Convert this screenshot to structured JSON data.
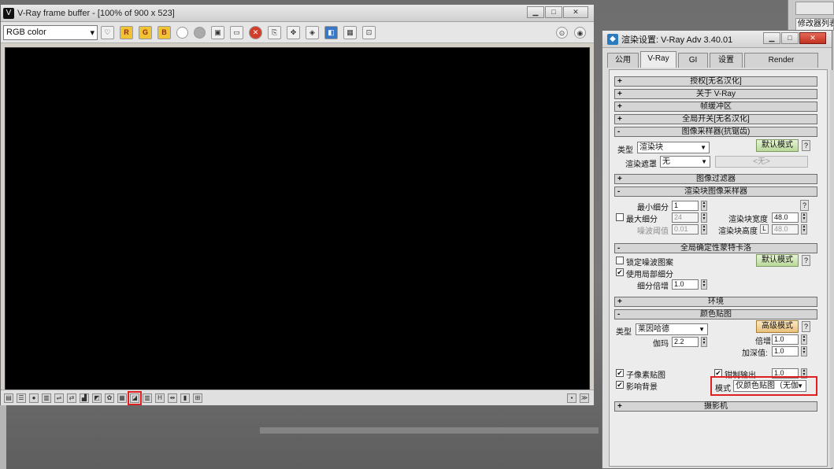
{
  "background": {
    "right_panel_label": "修改器列表"
  },
  "vfb": {
    "app_icon_glyph": "V",
    "title": "V-Ray frame buffer - [100% of 900 x 523]",
    "window_buttons": [
      "▁",
      "□",
      "✕"
    ],
    "channel": "RGB color",
    "toolbar_icons": [
      {
        "name": "color-balance-icon",
        "glyph": "♡",
        "style": ""
      },
      {
        "name": "red-channel-icon",
        "glyph": "R",
        "style": "rgb"
      },
      {
        "name": "green-channel-icon",
        "glyph": "G",
        "style": "rgb"
      },
      {
        "name": "blue-channel-icon",
        "glyph": "B",
        "style": "rgb"
      },
      {
        "name": "alpha-white-icon",
        "glyph": "",
        "style": "circle white"
      },
      {
        "name": "mono-gray-icon",
        "glyph": "",
        "style": "circle gray"
      },
      {
        "name": "save-icon",
        "glyph": "▣",
        "style": ""
      },
      {
        "name": "load-icon",
        "glyph": "▭",
        "style": ""
      },
      {
        "name": "clear-icon",
        "glyph": "✕",
        "style": "red"
      },
      {
        "name": "duplicate-icon",
        "glyph": "⎘",
        "style": ""
      },
      {
        "name": "track-mouse-icon",
        "glyph": "✥",
        "style": ""
      },
      {
        "name": "region-render-icon",
        "glyph": "◈",
        "style": ""
      },
      {
        "name": "link-to-max-icon",
        "glyph": "◧",
        "style": "blue"
      },
      {
        "name": "render-last-icon",
        "glyph": "▦",
        "style": ""
      },
      {
        "name": "region-select-icon",
        "glyph": "⊡",
        "style": ""
      }
    ],
    "toolbar_right_icons": [
      {
        "name": "stop-render-icon",
        "glyph": "⊙"
      },
      {
        "name": "render-icon",
        "glyph": "◉"
      }
    ],
    "statusbar_icons": [
      {
        "name": "history-icon",
        "glyph": "▤",
        "highlight": false
      },
      {
        "name": "lens-effects-icon",
        "glyph": "☰",
        "highlight": false
      },
      {
        "name": "info-icon",
        "glyph": "●",
        "highlight": false
      },
      {
        "name": "levels-icon",
        "glyph": "▥",
        "highlight": false
      },
      {
        "name": "curve-icon",
        "glyph": "⇌",
        "highlight": false
      },
      {
        "name": "exposure-icon",
        "glyph": "⇄",
        "highlight": false
      },
      {
        "name": "histogram-icon",
        "glyph": "▟",
        "highlight": false
      },
      {
        "name": "white-balance-icon",
        "glyph": "◩",
        "highlight": false
      },
      {
        "name": "hue-saturation-icon",
        "glyph": "✿",
        "highlight": false
      },
      {
        "name": "color-balance-sb-icon",
        "glyph": "▦",
        "highlight": false
      },
      {
        "name": "display-colorspace-icon",
        "glyph": "◪",
        "highlight": true
      },
      {
        "name": "lut-icon",
        "glyph": "▥",
        "highlight": false
      },
      {
        "name": "hflip-icon",
        "glyph": "H",
        "highlight": false
      },
      {
        "name": "vflip-icon",
        "glyph": "⇹",
        "highlight": false
      },
      {
        "name": "compare-icon",
        "glyph": "▮",
        "highlight": false
      },
      {
        "name": "pixel-aspect-icon",
        "glyph": "⊞",
        "highlight": false
      }
    ],
    "statusbar_right": [
      "▪",
      "≫"
    ]
  },
  "rs": {
    "app_icon_glyph": "◆",
    "title": "渲染设置: V-Ray Adv 3.40.01",
    "window_buttons": [
      "▁",
      "□",
      "✕"
    ],
    "tabs": [
      "公用",
      "V-Ray",
      "GI",
      "设置",
      "Render Elements"
    ],
    "active_tab": 1,
    "rollouts": {
      "r1": {
        "sign": "+",
        "title": "授权[无名汉化]"
      },
      "r2": {
        "sign": "+",
        "title": "关于 V-Ray"
      },
      "r3": {
        "sign": "+",
        "title": "帧缓冲区"
      },
      "r4": {
        "sign": "+",
        "title": "全局开关[无名汉化]"
      },
      "r5": {
        "sign": "-",
        "title": "图像采样器(抗锯齿)"
      },
      "r6": {
        "sign": "+",
        "title": "图像过滤器"
      },
      "r7": {
        "sign": "-",
        "title": "渲染块图像采样器"
      },
      "r8": {
        "sign": "-",
        "title": "全局确定性蒙特卡洛"
      },
      "r9": {
        "sign": "+",
        "title": "环境"
      },
      "r10": {
        "sign": "-",
        "title": "颜色贴图"
      },
      "r11": {
        "sign": "+",
        "title": "摄影机"
      }
    },
    "image_sampler": {
      "type_label": "类型",
      "type_value": "渲染块",
      "mask_label": "渲染遮罩",
      "mask_value": "无",
      "default_mode": "默认模式",
      "help": "?",
      "none_button": "<无>"
    },
    "bucket_sampler": {
      "min_subdivs_label": "最小细分",
      "min_subdivs": "1",
      "max_subdivs_label": "最大细分",
      "max_subdivs": "24",
      "noise_thresh_label": "噪波阈值",
      "noise_thresh": "0.01",
      "bucket_width_label": "渲染块宽度",
      "bucket_width": "48.0",
      "bucket_height_label": "渲染块高度",
      "bucket_height": "48.0",
      "lock_glyph": "L",
      "help": "?"
    },
    "dmc": {
      "lock_noise_label": "锁定噪波图案",
      "use_local_label": "使用局部细分",
      "subdivs_mult_label": "细分倍增",
      "subdivs_mult": "1.0",
      "default_mode": "默认模式",
      "help": "?"
    },
    "color_mapping": {
      "type_label": "类型",
      "type_value": "莱因哈德",
      "gamma_label": "伽玛",
      "gamma": "2.2",
      "advanced_mode": "高级模式",
      "help": "?",
      "multiplier_label": "倍增:",
      "multiplier": "1.0",
      "burn_label": "加深值:",
      "burn": "1.0",
      "subpixel_label": "子像素贴图",
      "affect_bg_label": "影响背景",
      "clamp_label": "钳制输出",
      "clamp_value": "1.0",
      "mode_label": "模式",
      "mode_value": "仅颜色贴图（无伽",
      "checks": {
        "subpixel": true,
        "affect_bg": true,
        "clamp": true,
        "lock_noise": false,
        "use_local": true,
        "max_subdivs": false
      }
    }
  }
}
